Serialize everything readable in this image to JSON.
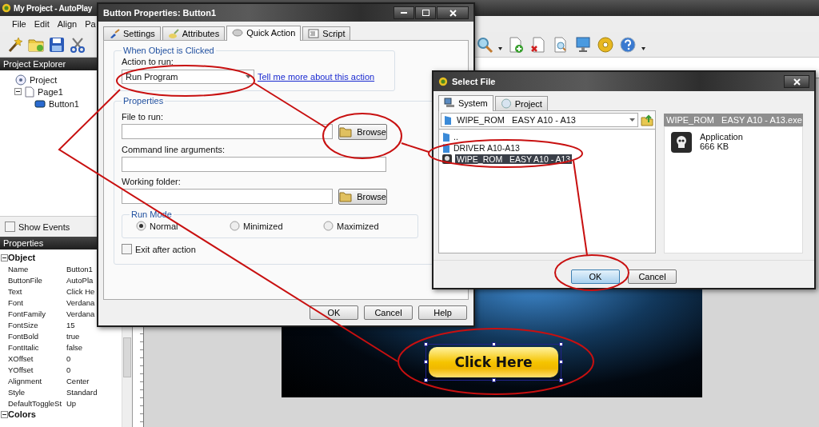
{
  "main_window": {
    "title": "My Project - AutoPlay",
    "menu": [
      "File",
      "Edit",
      "Align",
      "Pa"
    ],
    "project_explorer": {
      "title": "Project Explorer",
      "tree": [
        {
          "label": "Project",
          "kind": "project",
          "children": [
            {
              "label": "Page1",
              "kind": "page",
              "expanded": true,
              "children": [
                {
                  "label": "Button1",
                  "kind": "button"
                }
              ]
            }
          ]
        }
      ]
    },
    "show_events": {
      "label": "Show Events",
      "checked": false
    },
    "properties": {
      "title": "Properties",
      "groups": [
        {
          "name": "Object",
          "expanded": true,
          "rows": [
            {
              "name": "Name",
              "value": "Button1"
            },
            {
              "name": "ButtonFile",
              "value": "AutoPla"
            },
            {
              "name": "Text",
              "value": "Click He"
            },
            {
              "name": "Font",
              "value": "Verdana"
            },
            {
              "name": "FontFamily",
              "value": "Verdana"
            },
            {
              "name": "FontSize",
              "value": "15"
            },
            {
              "name": "FontBold",
              "value": "true"
            },
            {
              "name": "FontItalic",
              "value": "false"
            },
            {
              "name": "XOffset",
              "value": "0"
            },
            {
              "name": "YOffset",
              "value": "0"
            },
            {
              "name": "Alignment",
              "value": "Center"
            },
            {
              "name": "Style",
              "value": "Standard"
            },
            {
              "name": "DefaultToggleSt",
              "value": "Up"
            }
          ]
        },
        {
          "name": "Colors",
          "expanded": true
        }
      ]
    },
    "canvas": {
      "button_label": "Click Here"
    }
  },
  "button_properties": {
    "title": "Button Properties: Button1",
    "tabs": [
      {
        "label": "Settings",
        "selected": false
      },
      {
        "label": "Attributes",
        "selected": false
      },
      {
        "label": "Quick Action",
        "selected": true
      },
      {
        "label": "Script",
        "selected": false
      }
    ],
    "when_clicked": {
      "legend": "When Object is Clicked",
      "action_label": "Action to run:",
      "action_value": "Run Program",
      "help_link": "Tell me more about this action"
    },
    "properties": {
      "legend": "Properties",
      "fields": [
        {
          "label": "File to run:",
          "browse_button": "Browse"
        },
        {
          "label": "Command line arguments:"
        },
        {
          "label": "Working folder:",
          "browse_button": "Browse"
        }
      ],
      "run_mode": {
        "legend": "Run Mode",
        "options": [
          {
            "label": "Normal",
            "selected": true
          },
          {
            "label": "Minimized",
            "selected": false
          },
          {
            "label": "Maximized",
            "selected": false
          }
        ]
      },
      "exit_after_action": {
        "label": "Exit after action",
        "checked": false
      }
    },
    "buttons": [
      "OK",
      "Cancel",
      "Help"
    ]
  },
  "select_file": {
    "title": "Select File",
    "tabs": [
      {
        "label": "System",
        "selected": true
      },
      {
        "label": "Project",
        "selected": false
      }
    ],
    "folder": "WIPE_ROM   EASY A10 - A13",
    "files": [
      {
        "name": "..",
        "kind": "folder",
        "selected": false
      },
      {
        "name": "DRIVER A10-A13",
        "kind": "folder",
        "selected": false
      },
      {
        "name": "WIPE_ROM   EASY A10 - A13",
        "kind": "application",
        "selected": true
      }
    ],
    "preview": {
      "file_name": "WIPE_ROM   EASY A10 - A13.exe",
      "type": "Application",
      "size": "666 KB"
    },
    "buttons": [
      "OK",
      "Cancel"
    ]
  }
}
